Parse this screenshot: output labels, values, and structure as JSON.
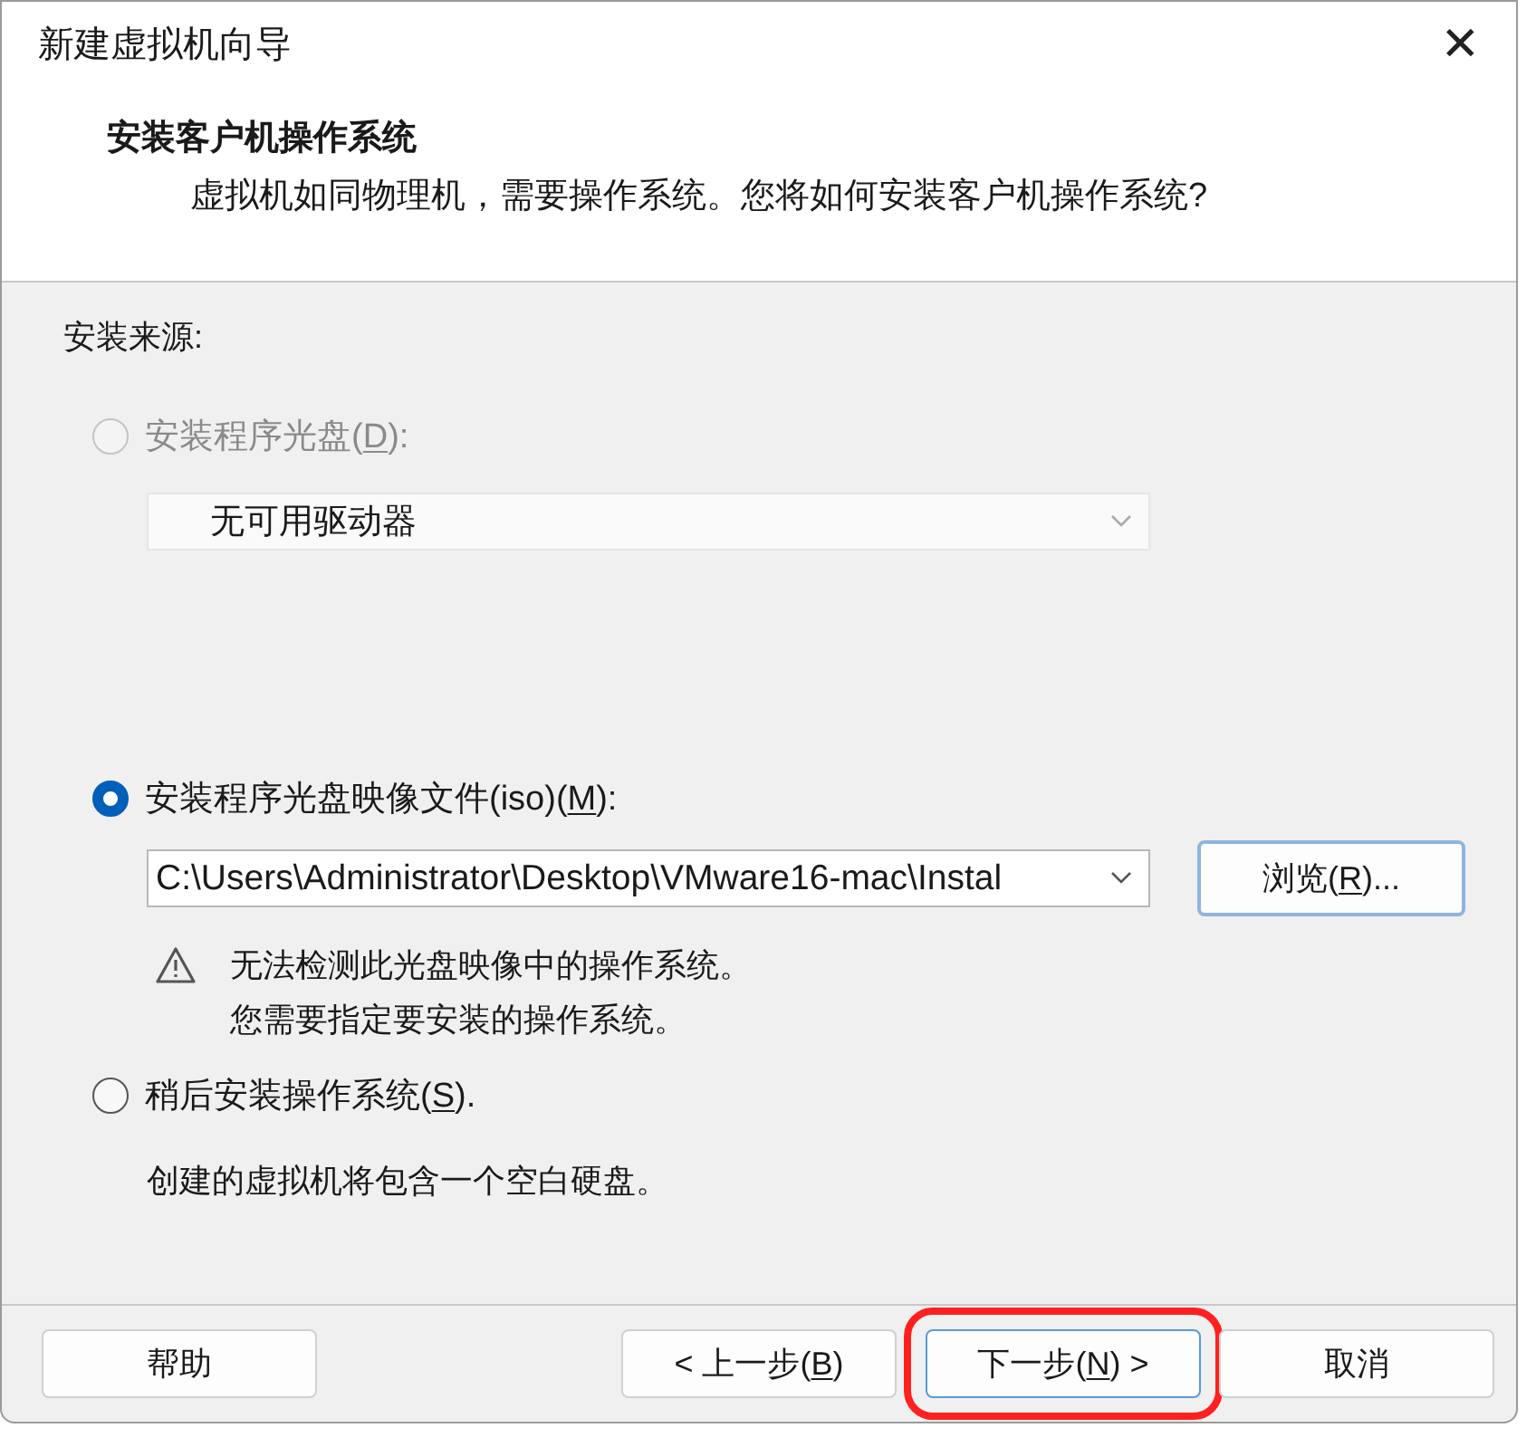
{
  "window": {
    "title": "新建虚拟机向导",
    "close": "✕"
  },
  "header": {
    "title": "安装客户机操作系统",
    "subtitle": "虚拟机如同物理机，需要操作系统。您将如何安装客户机操作系统?"
  },
  "source": {
    "label": "安装来源:",
    "options": [
      {
        "kind": "disc",
        "selected": false,
        "disabled": true,
        "label": {
          "before": "安装程序光盘(",
          "key": "D",
          "after": "):"
        },
        "drive": {
          "value": "无可用驱动器",
          "disabled": true
        }
      },
      {
        "kind": "image",
        "selected": true,
        "disabled": false,
        "label": {
          "before": "安装程序光盘映像文件(iso)(",
          "key": "M",
          "after": "):"
        },
        "path": {
          "value": "C:\\Users\\Administrator\\Desktop\\VMware16-mac\\Instal"
        },
        "browse": {
          "before": "浏览(",
          "key": "R",
          "after": ")..."
        },
        "warning": [
          "无法检测此光盘映像中的操作系统。",
          "您需要指定要安装的操作系统。"
        ]
      },
      {
        "kind": "later",
        "selected": false,
        "disabled": false,
        "label": {
          "before": "稍后安装操作系统(",
          "key": "S",
          "after": ")."
        },
        "description": "创建的虚拟机将包含一个空白硬盘。"
      }
    ]
  },
  "footer": {
    "buttons": [
      {
        "kind": "help",
        "label": {
          "before": "帮助"
        },
        "highlighted": false
      },
      {
        "kind": "back",
        "label": {
          "before": "< 上一步(",
          "key": "B",
          "after": ")"
        },
        "highlighted": false
      },
      {
        "kind": "next",
        "label": {
          "before": "下一步(",
          "key": "N",
          "after": ") >"
        },
        "highlighted": true
      },
      {
        "kind": "cancel",
        "label": {
          "before": "取消"
        },
        "highlighted": false
      }
    ]
  }
}
